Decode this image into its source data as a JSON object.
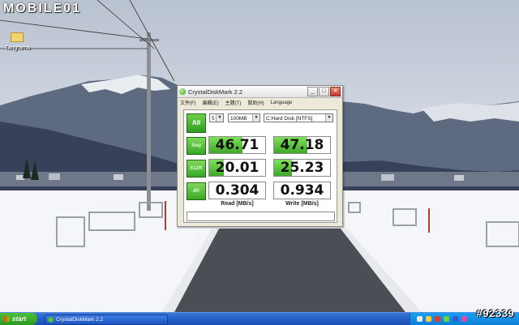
{
  "brand": {
    "text": "MOBILE01"
  },
  "desktop": {
    "icon_label": "Tangrama"
  },
  "window": {
    "title": "CrystalDiskMark 2.2",
    "minimize": "_",
    "maximize": "□",
    "close": "×",
    "menu": [
      "文件(F)",
      "編輯(E)",
      "主題(T)",
      "幫助(H)",
      "Language"
    ],
    "all_label": "All",
    "runs": "5",
    "size": "100MB",
    "drive": "C:Hard Disk [NTFS]",
    "rows": [
      {
        "label": "Seq",
        "read": "46.71",
        "write": "47.18",
        "read_fill": 0.6,
        "write_fill": 0.6
      },
      {
        "label": "512K",
        "read": "20.01",
        "write": "25.23",
        "read_fill": 0.26,
        "write_fill": 0.32
      },
      {
        "label": "4K",
        "read": "0.304",
        "write": "0.934",
        "read_fill": 0.0,
        "write_fill": 0.0
      }
    ],
    "read_header": "Read [MB/s]",
    "write_header": "Write [MB/s]"
  },
  "taskbar": {
    "start_label": "start",
    "task_label": "CrystalDiskMark 2.2"
  },
  "watermark": "#92339",
  "colors": {
    "accent_green": "#3fa82a",
    "taskbar_blue": "#245ec9"
  }
}
